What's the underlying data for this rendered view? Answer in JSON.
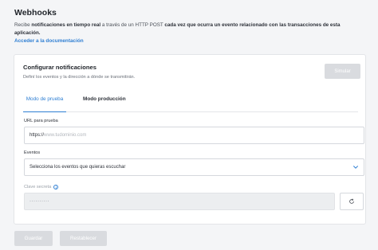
{
  "page": {
    "title": "Webhooks",
    "desc_1": "Recibe ",
    "desc_bold_1": "notificaciones en tiempo real",
    "desc_2": " a través de un HTTP POST ",
    "desc_bold_2": "cada vez que ocurra un evento relacionado con las transacciones de esta aplicación.",
    "doc_link": "Acceder a la documentación"
  },
  "card": {
    "title": "Configurar notificaciones",
    "subtitle": "Definí los eventos y la dirección a dónde se transmitirán.",
    "simulate_button": "Simular",
    "tabs": [
      {
        "label": "Modo de prueba",
        "active": true
      },
      {
        "label": "Modo producción",
        "active": false
      }
    ],
    "url_field": {
      "label": "URL para prueba",
      "prefix": "https://",
      "placeholder": "www.tudominio.com"
    },
    "events_field": {
      "label": "Eventos",
      "value": "Selecciona los eventos que quieras escuchar"
    },
    "secret_field": {
      "label": "Clave secreta",
      "value": "··········"
    }
  },
  "footer": {
    "save_button": "Guardar",
    "reset_button": "Restablecer"
  },
  "colors": {
    "accent": "#2f7fd3",
    "disabled_button": "#d9dbdf",
    "background": "#f4f5f7"
  },
  "icons": {
    "info": "info-icon",
    "chevron": "chevron-down-icon",
    "refresh": "refresh-icon"
  }
}
